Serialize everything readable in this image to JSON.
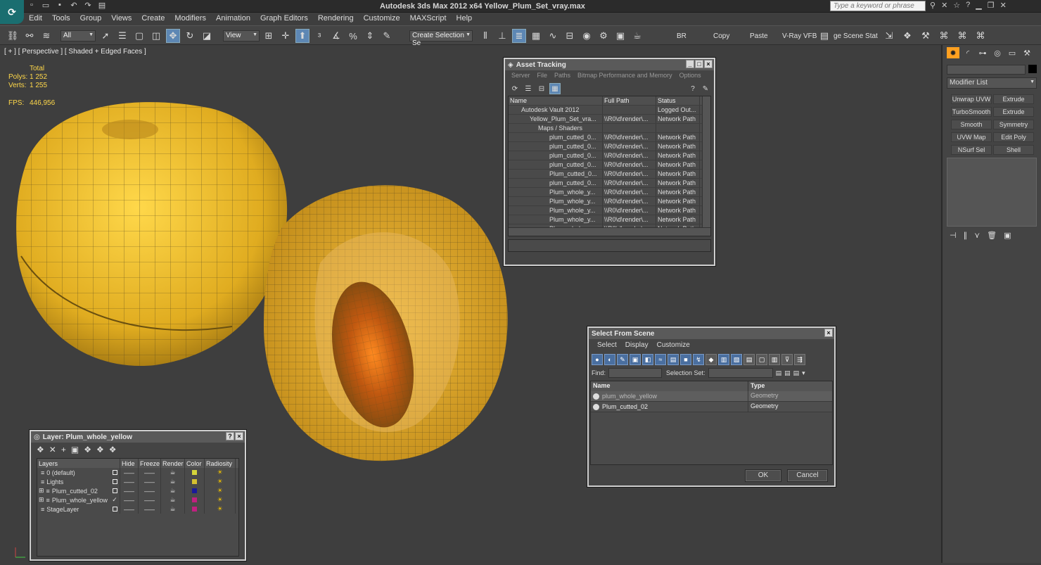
{
  "app": {
    "title": "Autodesk 3ds Max  2012 x64      Yellow_Plum_Set_vray.max",
    "search_placeholder": "Type a keyword or phrase",
    "logo": "3ds-max-logo-icon"
  },
  "menus": [
    "Edit",
    "Tools",
    "Group",
    "Views",
    "Create",
    "Modifiers",
    "Animation",
    "Graph Editors",
    "Rendering",
    "Customize",
    "MAXScript",
    "Help"
  ],
  "toolbar": {
    "selection_filter": "All",
    "ref_coord": "View",
    "named_selection": "Create Selection Se",
    "br_label": "BR",
    "copy_label": "Copy",
    "paste_label": "Paste",
    "vray_label": "V-Ray VFB",
    "scene_state_label": "ge Scene Stat"
  },
  "viewport": {
    "label": "[ + ] [ Perspective ] [ Shaded + Edged Faces ]",
    "stats_header": "Total",
    "polys_label": "Polys:",
    "polys_value": "1 252",
    "verts_label": "Verts:",
    "verts_value": "1 255",
    "fps_label": "FPS:",
    "fps_value": "446,956"
  },
  "command_panel": {
    "modifier_list": "Modifier List",
    "buttons": [
      "Unwrap UVW",
      "Extrude",
      "TurboSmooth",
      "Extrude",
      "Smooth",
      "Symmetry",
      "UVW Map",
      "Edit Poly",
      "NSurf Sel",
      "Shell"
    ]
  },
  "asset_tracking": {
    "title": "Asset Tracking",
    "menu": [
      "Server",
      "File",
      "Paths",
      "Bitmap Performance and Memory",
      "Options"
    ],
    "columns": [
      "Name",
      "Full Path",
      "Status"
    ],
    "rows": [
      {
        "name": "Autodesk Vault 2012",
        "path": "",
        "status": "Logged Out..."
      },
      {
        "name": "Yellow_Plum_Set_vra...",
        "path": "\\\\R0\\d\\render\\...",
        "status": "Network Path"
      },
      {
        "name": "Maps / Shaders",
        "path": "",
        "status": ""
      },
      {
        "name": "plum_cutted_0...",
        "path": "\\\\R0\\d\\render\\...",
        "status": "Network Path"
      },
      {
        "name": "plum_cutted_0...",
        "path": "\\\\R0\\d\\render\\...",
        "status": "Network Path"
      },
      {
        "name": "plum_cutted_0...",
        "path": "\\\\R0\\d\\render\\...",
        "status": "Network Path"
      },
      {
        "name": "plum_cutted_0...",
        "path": "\\\\R0\\d\\render\\...",
        "status": "Network Path"
      },
      {
        "name": "Plum_cutted_0...",
        "path": "\\\\R0\\d\\render\\...",
        "status": "Network Path"
      },
      {
        "name": "plum_cutted_0...",
        "path": "\\\\R0\\d\\render\\...",
        "status": "Network Path"
      },
      {
        "name": "Plum_whole_y...",
        "path": "\\\\R0\\d\\render\\...",
        "status": "Network Path"
      },
      {
        "name": "Plum_whole_y...",
        "path": "\\\\R0\\d\\render\\...",
        "status": "Network Path"
      },
      {
        "name": "Plum_whole_y...",
        "path": "\\\\R0\\d\\render\\...",
        "status": "Network Path"
      },
      {
        "name": "Plum_whole_y...",
        "path": "\\\\R0\\d\\render\\...",
        "status": "Network Path"
      },
      {
        "name": "Plum_whole_y...",
        "path": "\\\\R0\\d\\render\\...",
        "status": "Network Path"
      }
    ]
  },
  "select_from_scene": {
    "title": "Select From Scene",
    "menu": [
      "Select",
      "Display",
      "Customize"
    ],
    "find_label": "Find:",
    "selection_set_label": "Selection Set:",
    "columns": [
      "Name",
      "Type"
    ],
    "rows": [
      {
        "name": "plum_whole_yellow",
        "type": "Geometry"
      },
      {
        "name": "Plum_cutted_02",
        "type": "Geometry"
      }
    ],
    "ok_label": "OK",
    "cancel_label": "Cancel"
  },
  "layer_manager": {
    "title": "Layer: Plum_whole_yellow",
    "columns": [
      "Layers",
      "Hide",
      "Freeze",
      "Render",
      "Color",
      "Radiosity"
    ],
    "rows": [
      {
        "name": "0 (default)",
        "color": "#d4d43a",
        "current": ""
      },
      {
        "name": "Lights",
        "color": "#d4c030",
        "current": ""
      },
      {
        "name": "Plum_cutted_02",
        "color": "#1a1a9a",
        "current": ""
      },
      {
        "name": "Plum_whole_yellow",
        "color": "#c02080",
        "current": "✓"
      },
      {
        "name": "StageLayer",
        "color": "#c02080",
        "current": ""
      }
    ]
  }
}
